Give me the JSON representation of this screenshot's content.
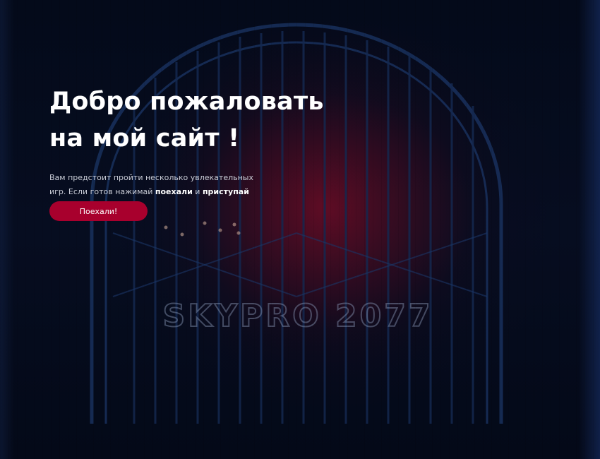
{
  "hero": {
    "title_line1": "Добро пожаловать",
    "title_line2": "на мой сайт !",
    "text_part1": "Вам предстоит пройти несколько увлекательных игр. Если готов нажимай ",
    "text_bold1": "поехали",
    "text_part2": " и ",
    "text_bold2": "приступай",
    "button_label": "Поехали!"
  },
  "background": {
    "sign_text": "SKYPRO 2077"
  },
  "colors": {
    "background": "#050b1a",
    "accent": "#a8002d",
    "heading": "#ffffff",
    "body_text": "#c9ccd6",
    "neon_sign": "#8a9ab8",
    "gate_lines": "#1b3566"
  }
}
